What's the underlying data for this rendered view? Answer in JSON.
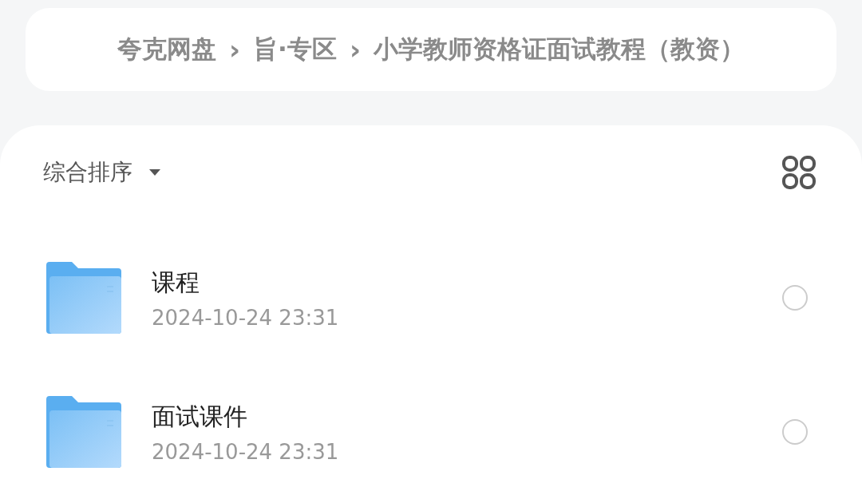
{
  "breadcrumb": [
    {
      "label": "夸克网盘"
    },
    {
      "label": "旨·专区"
    },
    {
      "label": "小学教师资格证面试教程（教资）"
    }
  ],
  "breadcrumb_separator": "›",
  "sort": {
    "label": "综合排序"
  },
  "files": [
    {
      "name": "课程",
      "date": "2024-10-24 23:31",
      "selected": false
    },
    {
      "name": "面试课件",
      "date": "2024-10-24 23:31",
      "selected": false
    }
  ]
}
